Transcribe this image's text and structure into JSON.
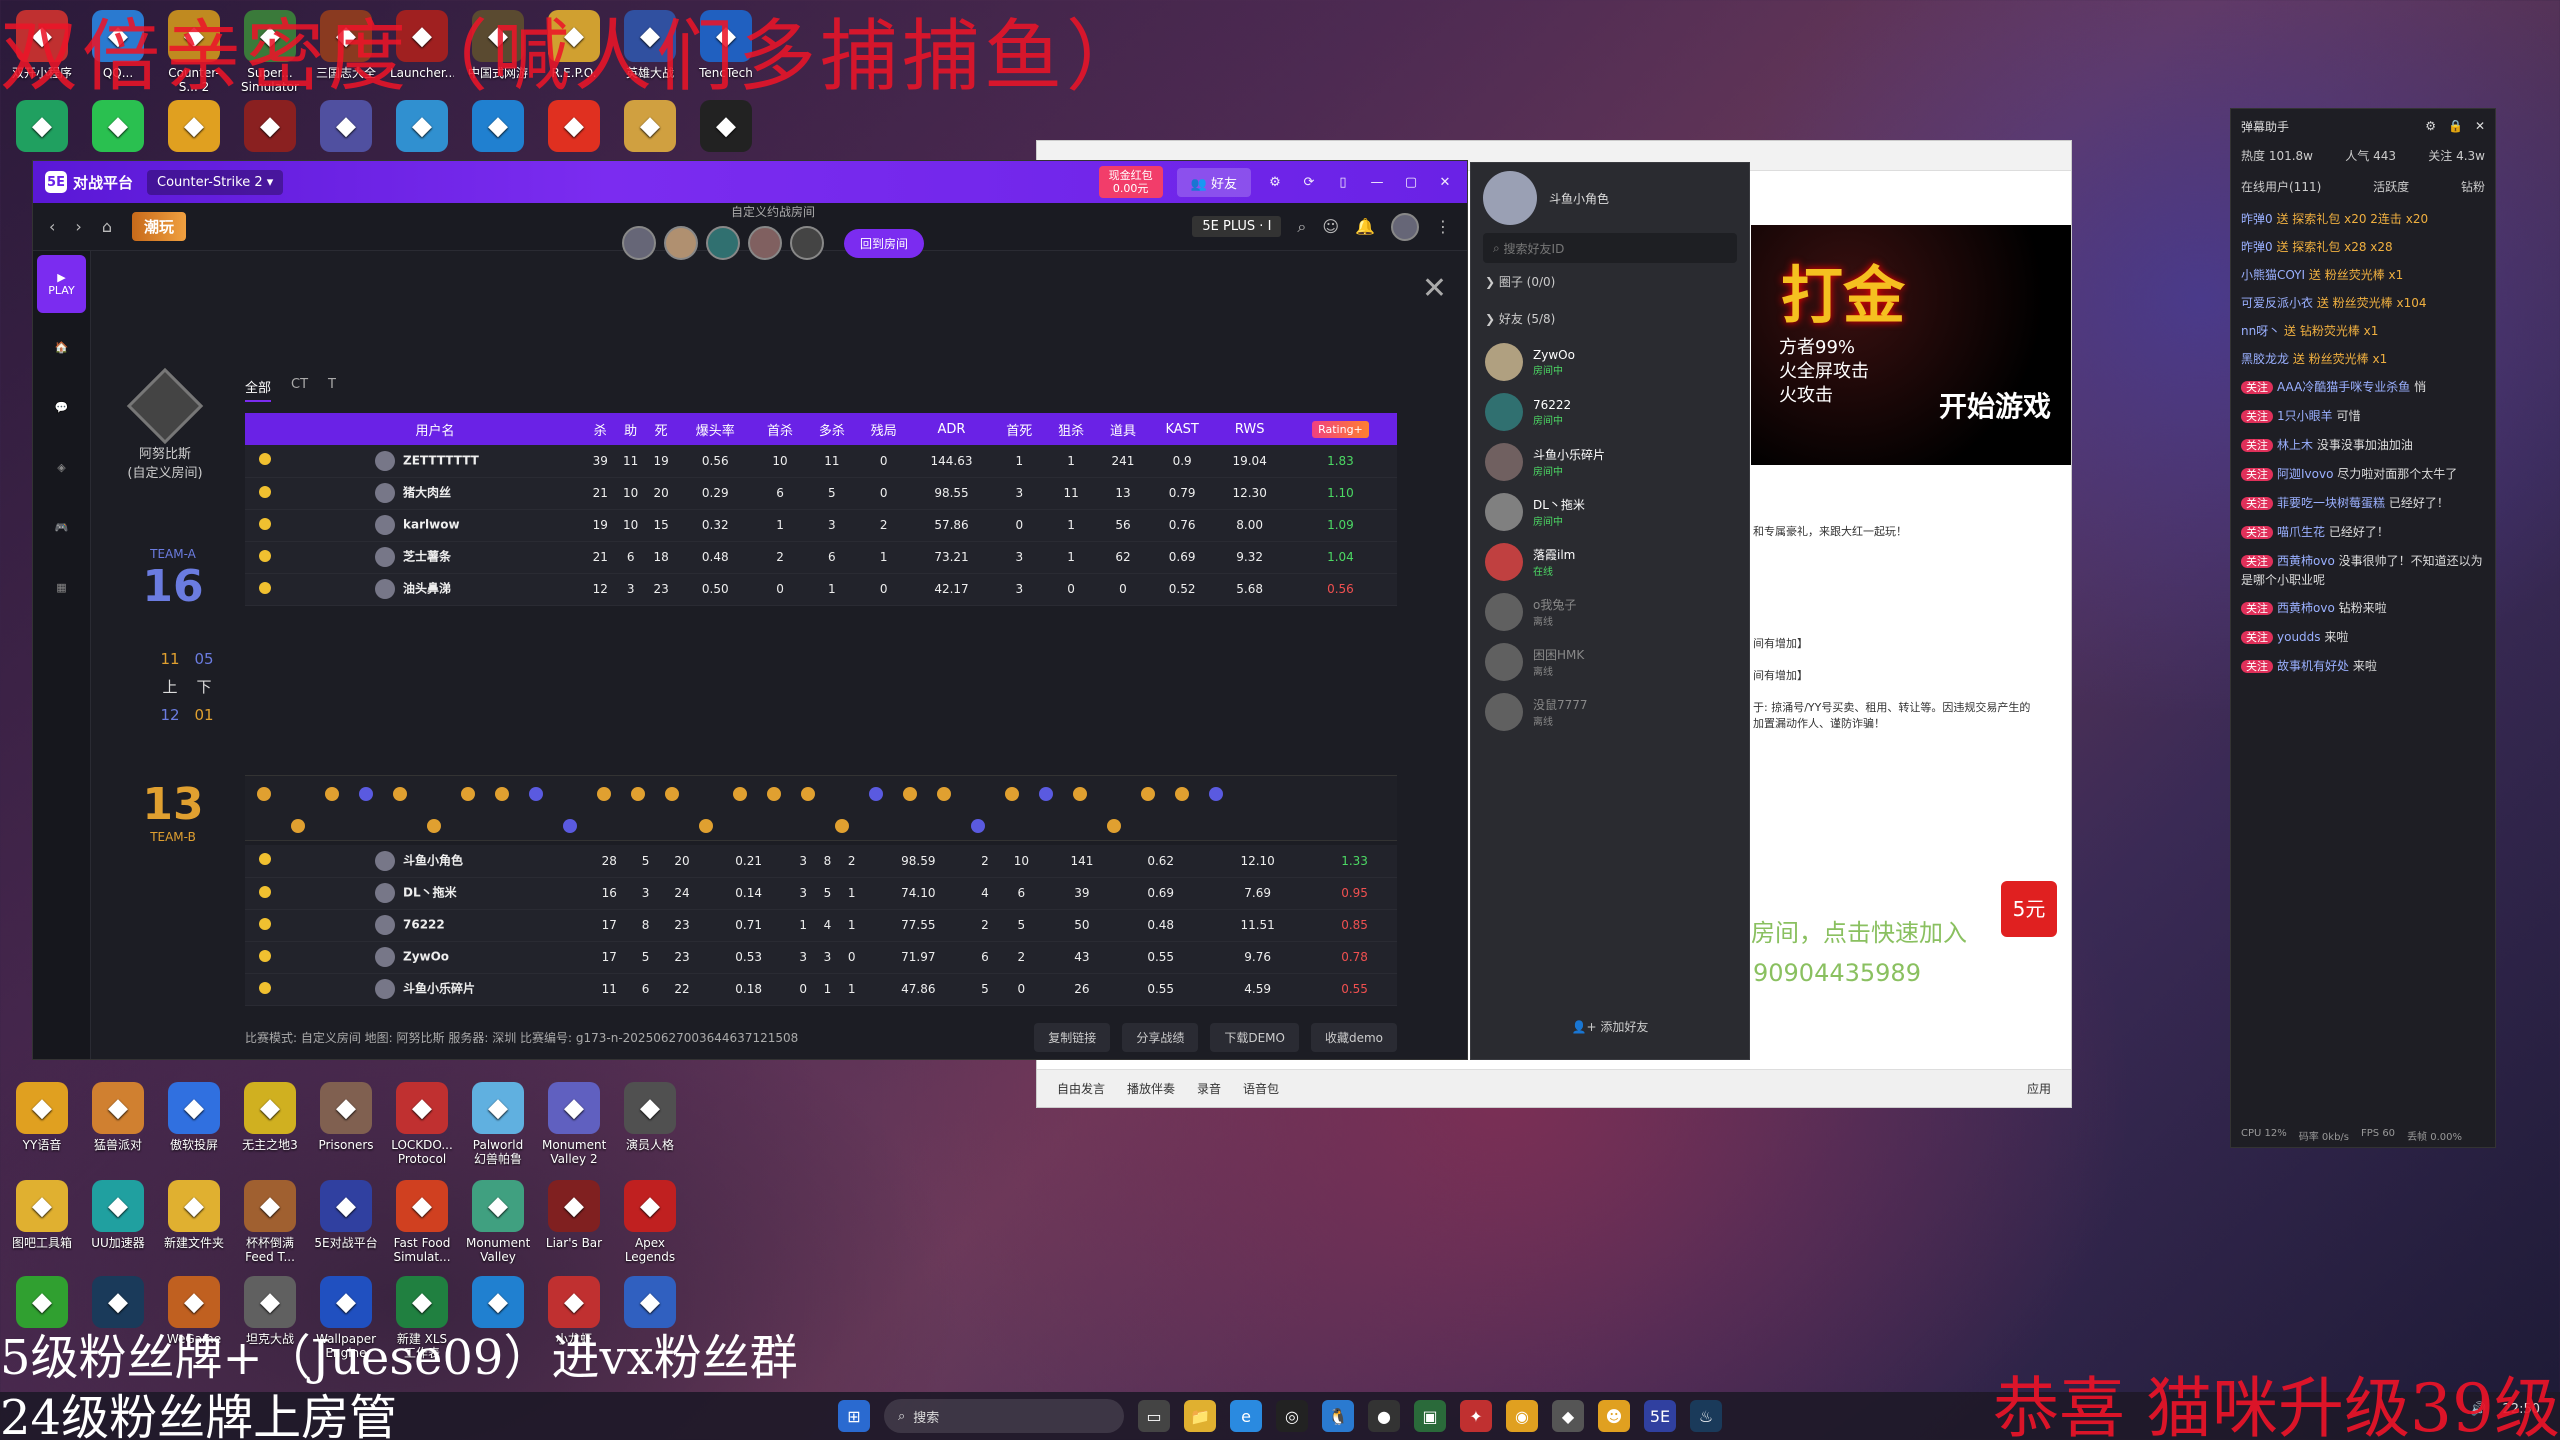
{
  "overlay": {
    "top_text": "双倍亲密度（喊人们多捕捕鱼）",
    "bottom_line1": "5级粉丝牌+（Juese09）进vx粉丝群",
    "bottom_line2": "24级粉丝牌上房管",
    "bottom_right": "恭喜 猫咪升级39级"
  },
  "desktop_top_row": [
    {
      "label": "双开小程序",
      "icon": "app-icon",
      "color": "#c03030"
    },
    {
      "label": "QQ...",
      "icon": "qq-icon",
      "color": "#2a7ad0"
    },
    {
      "label": "Counter-S... 2",
      "icon": "cs2-icon",
      "color": "#c08a20"
    },
    {
      "label": "Super... Simulator",
      "icon": "game-icon",
      "color": "#3a7a3a"
    },
    {
      "label": "三国志大全",
      "icon": "game-icon",
      "color": "#8a3a20"
    },
    {
      "label": "Launcher...",
      "icon": "launcher-icon",
      "color": "#a02020"
    },
    {
      "label": "中国式网游",
      "icon": "game-icon",
      "color": "#5a4a30"
    },
    {
      "label": "R.E.P.O.",
      "icon": "game-icon",
      "color": "#d0a030"
    },
    {
      "label": "英雄大战",
      "icon": "game-icon",
      "color": "#3050a0"
    },
    {
      "label": "TencTech",
      "icon": "tencent-icon",
      "color": "#2060c0"
    }
  ],
  "desktop_second_row": [
    {
      "label": "",
      "icon": "app-icon",
      "color": "#20a060"
    },
    {
      "label": "",
      "icon": "wechat-icon",
      "color": "#2ac050"
    },
    {
      "label": "",
      "icon": "chrome-icon",
      "color": "#e0a020"
    },
    {
      "label": "",
      "icon": "game-icon",
      "color": "#8a2020"
    },
    {
      "label": "",
      "icon": "game-icon",
      "color": "#5050a0"
    },
    {
      "label": "",
      "icon": "game-icon",
      "color": "#3090d0"
    },
    {
      "label": "",
      "icon": "qq-icon",
      "color": "#2080d0"
    },
    {
      "label": "",
      "icon": "ea-icon",
      "color": "#e03020"
    },
    {
      "label": "",
      "icon": "game-icon",
      "color": "#d0a040"
    },
    {
      "label": "",
      "icon": "app-icon",
      "color": "#222222"
    }
  ],
  "desktop_bottom_row1": [
    {
      "label": "YY语音",
      "icon": "yy-icon",
      "color": "#e0a020"
    },
    {
      "label": "猛兽派对",
      "icon": "game-icon",
      "color": "#d08030"
    },
    {
      "label": "傲软投屏",
      "icon": "app-icon",
      "color": "#3070e0"
    },
    {
      "label": "无主之地3",
      "icon": "game-icon",
      "color": "#d0b020"
    },
    {
      "label": "Prisoners",
      "icon": "game-icon",
      "color": "#806050"
    },
    {
      "label": "LOCKDO... Protocol",
      "icon": "game-icon",
      "color": "#c03030"
    },
    {
      "label": "Palworld 幻兽帕鲁",
      "icon": "game-icon",
      "color": "#60b0e0"
    },
    {
      "label": "Monument Valley 2",
      "icon": "game-icon",
      "color": "#6060c0"
    },
    {
      "label": "演员人格",
      "icon": "game-icon",
      "color": "#505050"
    }
  ],
  "desktop_bottom_row2": [
    {
      "label": "图吧工具箱",
      "icon": "folder-icon",
      "color": "#e0b030"
    },
    {
      "label": "UU加速器",
      "icon": "app-icon",
      "color": "#20a0a0"
    },
    {
      "label": "新建文件夹",
      "icon": "folder-icon",
      "color": "#e0b030"
    },
    {
      "label": "杯杯倒满 Feed T...",
      "icon": "game-icon",
      "color": "#a06030"
    },
    {
      "label": "5E对战平台",
      "icon": "app-icon",
      "color": "#3040a0"
    },
    {
      "label": "Fast Food Simulat...",
      "icon": "game-icon",
      "color": "#d04020"
    },
    {
      "label": "Monument Valley",
      "icon": "game-icon",
      "color": "#40a080"
    },
    {
      "label": "Liar's Bar",
      "icon": "game-icon",
      "color": "#802020"
    },
    {
      "label": "Apex Legends",
      "icon": "game-icon",
      "color": "#c02020"
    }
  ],
  "desktop_bottom_row3": [
    {
      "label": "",
      "icon": "app-icon",
      "color": "#30a030"
    },
    {
      "label": "",
      "icon": "steam-icon",
      "color": "#1a3a5a"
    },
    {
      "label": "WeGame",
      "icon": "app-icon",
      "color": "#c06020"
    },
    {
      "label": "坦克大战",
      "icon": "game-icon",
      "color": "#606060"
    },
    {
      "label": "Wallpaper Engine",
      "icon": "app-icon",
      "color": "#2050c0"
    },
    {
      "label": "新建 XLS 工作表",
      "icon": "excel-icon",
      "color": "#208040"
    },
    {
      "label": "",
      "icon": "qq-icon",
      "color": "#2080d0"
    },
    {
      "label": "小龙虾",
      "icon": "game-icon",
      "color": "#c03030"
    },
    {
      "label": "",
      "icon": "app-icon",
      "color": "#3060c0"
    }
  ],
  "platform": {
    "logo": "对战平台",
    "game": "Counter-Strike 2",
    "wallet_label": "现金红包",
    "wallet_value": "0.00元",
    "friend_btn": "好友",
    "brand": "潮玩",
    "room_title": "自定义约战房间",
    "back_room": "回到房间",
    "rank": "5E PLUS · I",
    "rail_play": "PLAY",
    "map_name": "阿努比斯",
    "map_mode": "(自定义房间)",
    "team_a_label": "TEAM-A",
    "team_a_score": "16",
    "team_b_label": "TEAM-B",
    "team_b_score": "13",
    "halves": {
      "a1": "11",
      "a2": "05",
      "h1": "上",
      "h2": "下",
      "b1": "12",
      "b2": "01"
    },
    "tabs": [
      "全部",
      "CT",
      "T"
    ],
    "columns": [
      "用户名",
      "杀",
      "助",
      "死",
      "爆头率",
      "首杀",
      "多杀",
      "残局",
      "ADR",
      "首死",
      "狙杀",
      "道具",
      "KAST",
      "RWS",
      "Rating+"
    ],
    "team_a_rows": [
      {
        "name": "ZETTTTTTT",
        "k": "39",
        "a": "11",
        "d": "19",
        "hs": "0.56",
        "fk": "10",
        "mk": "11",
        "cl": "0",
        "adr": "144.63",
        "fd": "1",
        "sk": "1",
        "ut": "241",
        "kast": "0.9",
        "rws": "19.04",
        "rating": "1.83",
        "hi": true
      },
      {
        "name": "猪大肉丝",
        "k": "21",
        "a": "10",
        "d": "20",
        "hs": "0.29",
        "fk": "6",
        "mk": "5",
        "cl": "0",
        "adr": "98.55",
        "fd": "3",
        "sk": "11",
        "ut": "13",
        "kast": "0.79",
        "rws": "12.30",
        "rating": "1.10",
        "hi": true
      },
      {
        "name": "karlwow",
        "k": "19",
        "a": "10",
        "d": "15",
        "hs": "0.32",
        "fk": "1",
        "mk": "3",
        "cl": "2",
        "adr": "57.86",
        "fd": "0",
        "sk": "1",
        "ut": "56",
        "kast": "0.76",
        "rws": "8.00",
        "rating": "1.09",
        "hi": true
      },
      {
        "name": "芝士薯条",
        "k": "21",
        "a": "6",
        "d": "18",
        "hs": "0.48",
        "fk": "2",
        "mk": "6",
        "cl": "1",
        "adr": "73.21",
        "fd": "3",
        "sk": "1",
        "ut": "62",
        "kast": "0.69",
        "rws": "9.32",
        "rating": "1.04",
        "hi": true
      },
      {
        "name": "油头鼻涕",
        "k": "12",
        "a": "3",
        "d": "23",
        "hs": "0.50",
        "fk": "0",
        "mk": "1",
        "cl": "0",
        "adr": "42.17",
        "fd": "3",
        "sk": "0",
        "ut": "0",
        "kast": "0.52",
        "rws": "5.68",
        "rating": "0.56",
        "hi": false
      }
    ],
    "team_b_rows": [
      {
        "name": "斗鱼小角色",
        "k": "28",
        "a": "5",
        "d": "20",
        "hs": "0.21",
        "fk": "3",
        "mk": "8",
        "cl": "2",
        "adr": "98.59",
        "fd": "2",
        "sk": "10",
        "ut": "141",
        "kast": "0.62",
        "rws": "12.10",
        "rating": "1.33",
        "hi": true
      },
      {
        "name": "DL丶拖米",
        "k": "16",
        "a": "3",
        "d": "24",
        "hs": "0.14",
        "fk": "3",
        "mk": "5",
        "cl": "1",
        "adr": "74.10",
        "fd": "4",
        "sk": "6",
        "ut": "39",
        "kast": "0.69",
        "rws": "7.69",
        "rating": "0.95",
        "hi": false
      },
      {
        "name": "76222",
        "k": "17",
        "a": "8",
        "d": "23",
        "hs": "0.71",
        "fk": "1",
        "mk": "4",
        "cl": "1",
        "adr": "77.55",
        "fd": "2",
        "sk": "5",
        "ut": "50",
        "kast": "0.48",
        "rws": "11.51",
        "rating": "0.85",
        "hi": false
      },
      {
        "name": "ZywOo",
        "k": "17",
        "a": "5",
        "d": "23",
        "hs": "0.53",
        "fk": "3",
        "mk": "3",
        "cl": "0",
        "adr": "71.97",
        "fd": "6",
        "sk": "2",
        "ut": "43",
        "kast": "0.55",
        "rws": "9.76",
        "rating": "0.78",
        "hi": false
      },
      {
        "name": "斗鱼小乐碎片",
        "k": "11",
        "a": "6",
        "d": "22",
        "hs": "0.18",
        "fk": "0",
        "mk": "1",
        "cl": "1",
        "adr": "47.86",
        "fd": "5",
        "sk": "0",
        "ut": "26",
        "kast": "0.55",
        "rws": "4.59",
        "rating": "0.55",
        "hi": false
      }
    ],
    "footer_info": "比赛模式: 自定义房间  地图: 阿努比斯  服务器: 深圳  比赛编号: g173-n-20250627003644637121508",
    "footer_buttons": [
      "复制链接",
      "分享战绩",
      "下载DEMO",
      "收藏demo"
    ]
  },
  "friend_panel": {
    "user": "斗鱼小角色",
    "search_placeholder": "搜索好友ID",
    "group1": "❯ 圈子 (0/0)",
    "group2": "❯ 好友 (5/8)",
    "friends": [
      {
        "name": "ZywOo",
        "status": "房间中",
        "online": true,
        "color": "#b0a080"
      },
      {
        "name": "76222",
        "status": "房间中",
        "online": true,
        "color": "#307070"
      },
      {
        "name": "斗鱼小乐碎片",
        "status": "房间中",
        "online": true,
        "color": "#706060"
      },
      {
        "name": "DL丶拖米",
        "status": "房间中",
        "online": true,
        "color": "#808080"
      },
      {
        "name": "落霞ilm",
        "status": "在线",
        "online": true,
        "color": "#c04040"
      },
      {
        "name": "o我兔子",
        "status": "离线",
        "online": false,
        "color": "#606060"
      },
      {
        "name": "困困HMK",
        "status": "离线",
        "online": false,
        "color": "#606060"
      },
      {
        "name": "没鼠7777",
        "status": "离线",
        "online": false,
        "color": "#606060"
      }
    ],
    "add_friend": "添加好友"
  },
  "chat": {
    "ad_title": "打金",
    "ad_line1": "方者99%",
    "ad_line2": "火全屏攻击",
    "ad_line3": "火攻击",
    "ad_btn": "开始游戏",
    "text1": "和专属豪礼，来跟大红一起玩！",
    "text2": "间有增加】",
    "text3": "间有增加】",
    "text4": "于: 掠涌号/YY号买卖、租用、转让等。因违规交易产生的",
    "text5": "加置漏动作人、谨防诈骗！",
    "big_text": "房间，点击快速加入",
    "num_text": "90904435989",
    "promo": "5元",
    "toolbar": [
      "自由发言",
      "播放伴奏",
      "录音",
      "语音包",
      "应用"
    ]
  },
  "danmu": {
    "title": "弹幕助手",
    "heat": "热度 101.8w",
    "popularity": "人气 443",
    "follow": "关注 4.3w",
    "tab_online": "在线用户(111)",
    "tab_active": "活跃度",
    "tab_diamond": "钻粉",
    "lines": [
      {
        "user": "昨弹0",
        "text": "送 探索礼包 x20 2连击 x20",
        "type": "gift"
      },
      {
        "user": "昨弹0",
        "text": "送 探索礼包 x28 x28",
        "type": "gift"
      },
      {
        "user": "小熊猫COYI",
        "text": "送 粉丝荧光棒 x1",
        "type": "gift"
      },
      {
        "user": "可爱反派小衣",
        "text": "送 粉丝荧光棒 x104",
        "type": "gift"
      },
      {
        "user": "nn呀丶",
        "text": "送 钻粉荧光棒 x1",
        "type": "gift"
      },
      {
        "user": "黑胶龙龙",
        "text": "送 粉丝荧光棒 x1",
        "type": "gift"
      },
      {
        "user": "AAA冷酷猫手咪专业杀鱼",
        "text": "悄",
        "type": "chat"
      },
      {
        "user": "1只小眼羊",
        "text": "可惜",
        "type": "chat"
      },
      {
        "user": "林上木",
        "text": "没事没事加油加油",
        "type": "chat"
      },
      {
        "user": "阿迦Ivovo",
        "text": "尽力啦对面那个太牛了",
        "type": "chat"
      },
      {
        "user": "菲要吃一块树莓蛋糕",
        "text": "已经好了！",
        "type": "chat"
      },
      {
        "user": "喵爪生花",
        "text": "已经好了！",
        "type": "chat"
      },
      {
        "user": "西黄柿ovo",
        "text": "没事很帅了！不知道还以为是哪个小职业呢",
        "type": "chat"
      },
      {
        "user": "西黄柿ovo",
        "text": "钻粉来啦",
        "type": "chat"
      },
      {
        "user": "youdds",
        "text": "来啦",
        "type": "chat"
      },
      {
        "user": "故事机有好处",
        "text": "来啦",
        "type": "chat"
      }
    ],
    "footer": [
      "CPU 12%",
      "码率 0kb/s",
      "FPS 60",
      "丢帧 0.00%"
    ]
  },
  "taskbar": {
    "search": "搜索",
    "time": "22:50"
  }
}
